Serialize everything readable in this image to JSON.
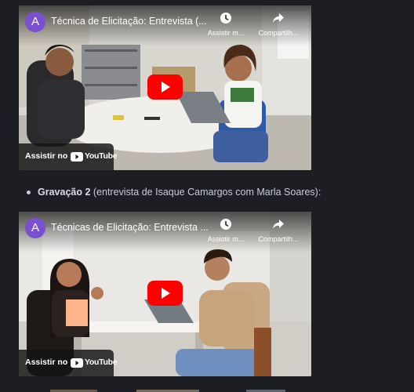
{
  "videos": [
    {
      "channel_initial": "A",
      "title": "Técnica de Elicitação: Entrevista (...",
      "watch_later_label": "Assistir m...",
      "share_label": "Compartilh...",
      "watch_on_label": "Assistir no",
      "youtube_label": "YouTube"
    },
    {
      "channel_initial": "A",
      "title": "Técnicas de Elicitação: Entrevista ...",
      "watch_later_label": "Assistir m...",
      "share_label": "Compartilh...",
      "watch_on_label": "Assistir no",
      "youtube_label": "YouTube"
    }
  ],
  "bullet": {
    "bold": "Gravação 2",
    "rest": " (entrevista de Isaque Camargos com Marla Soares):"
  },
  "colors": {
    "background": "#1c1e24",
    "avatar": "#7a4fd0",
    "youtube_red": "#ff0000"
  },
  "icons": [
    "clock-icon",
    "share-icon",
    "play-icon",
    "youtube-logo-icon"
  ]
}
